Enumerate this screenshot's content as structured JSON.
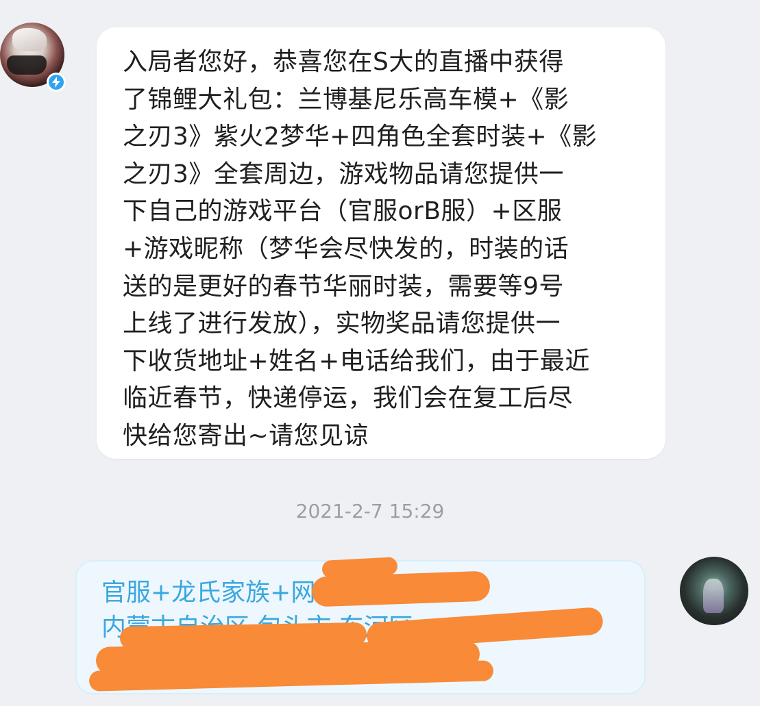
{
  "incoming_message": {
    "avatar_icon": "user-avatar-icon",
    "badge_icon": "lightning-badge-icon",
    "text": "入局者您好，恭喜您在S大的直播中获得\n了锦鲤大礼包：兰博基尼乐高车模+《影\n之刃3》紫火2梦华+四角色全套时装+《影\n之刃3》全套周边，游戏物品请您提供一\n下自己的游戏平台（官服orB服）+区服\n+游戏昵称（梦华会尽快发的，时装的话\n送的是更好的春节华丽时装，需要等9号\n上线了进行发放），实物奖品请您提供一\n下收货地址+姓名+电话给我们，由于最近\n临近春节，快递停运，我们会在复工后尽\n快给您寄出~请您见谅"
  },
  "timestamp": "2021-2-7 15:29",
  "outgoing_message": {
    "line1": "官服+龙氏家族+网",
    "line2": "内蒙古自治区 包头市 东河区",
    "line3": "",
    "avatar_icon": "user-avatar-icon",
    "redaction_color": "#f88a38"
  },
  "colors": {
    "background": "#eef0f3",
    "incoming_bubble": "#ffffff",
    "outgoing_bubble": "#edf7fd",
    "outgoing_text": "#3aa7df",
    "timestamp_text": "#9a9ea6"
  }
}
